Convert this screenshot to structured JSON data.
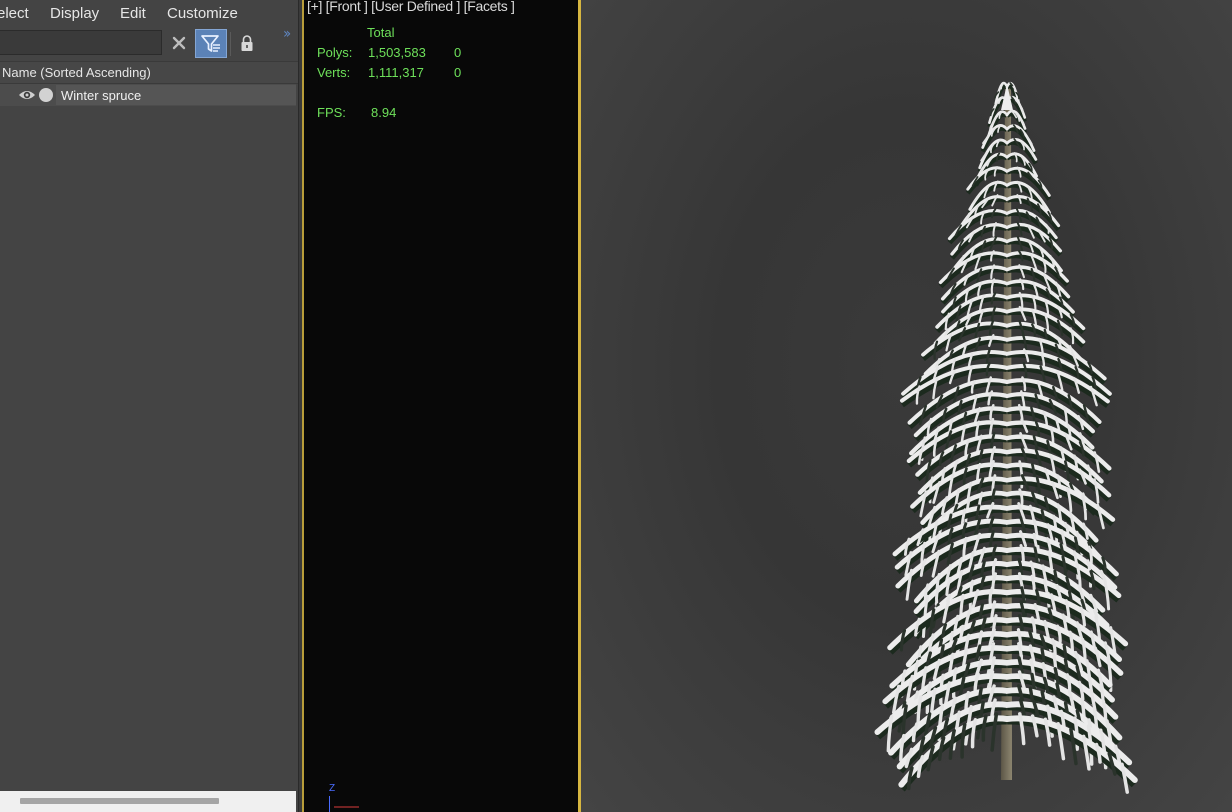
{
  "menubar": {
    "items": [
      "elect",
      "Display",
      "Edit",
      "Customize"
    ]
  },
  "toolbar": {
    "search_value": "",
    "search_placeholder": ""
  },
  "explorer": {
    "column_header": "Name (Sorted Ascending)",
    "rows": [
      {
        "label": "Winter spruce",
        "visible": true
      }
    ]
  },
  "front_viewport": {
    "label": "[+] [Front ] [User Defined ] [Facets ]",
    "stats": {
      "total_header": "Total",
      "polys_label": "Polys:",
      "polys_total": "1,503,583",
      "polys_selected": "0",
      "verts_label": "Verts:",
      "verts_total": "1,111,317",
      "verts_selected": "0",
      "fps_label": "FPS:",
      "fps_value": "8.94"
    },
    "axis_label": "Z"
  },
  "colors": {
    "stats_text": "#6ee05a",
    "active_viewport_border": "#d6b640",
    "filter_button": "#5b82b7"
  },
  "icons": [
    "close-icon",
    "filter-icon",
    "lock-icon",
    "expand-chevron-icon",
    "eye-icon",
    "dot-icon"
  ]
}
